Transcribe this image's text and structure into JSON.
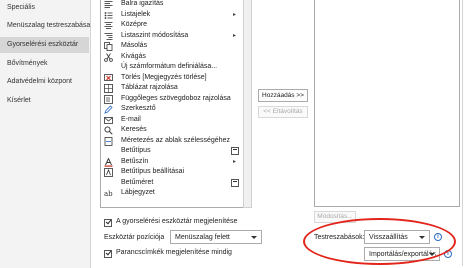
{
  "nav": {
    "items": [
      {
        "label": "Speciális"
      },
      {
        "label": "Menüszalag testreszabása"
      },
      {
        "label": "Gyorselérési eszköztár",
        "selected": true
      },
      {
        "label": "Bővítmények"
      },
      {
        "label": "Adatvédelmi központ"
      },
      {
        "label": "Kísérlet"
      }
    ]
  },
  "commands": [
    {
      "icon": "align-left-icon",
      "label": "Balra igazítás"
    },
    {
      "icon": "bullets-icon",
      "label": "Listajelek",
      "submenu": true
    },
    {
      "icon": "align-center-icon",
      "label": "Középre"
    },
    {
      "icon": "list-level-icon",
      "label": "Listaszint módosítása",
      "submenu": true
    },
    {
      "icon": "copy-icon",
      "label": "Másolás"
    },
    {
      "icon": "cut-icon",
      "label": "Kivágás"
    },
    {
      "icon": "",
      "label": "Új számformátum definiálása..."
    },
    {
      "icon": "delete-comment-icon",
      "label": "Törlés [Megjegyzés törlése]"
    },
    {
      "icon": "draw-table-icon",
      "label": "Táblázat rajzolása"
    },
    {
      "icon": "vertical-textbox-icon",
      "label": "Függőleges szövegdoboz rajzolása"
    },
    {
      "icon": "editor-icon",
      "label": "Szerkesztő"
    },
    {
      "icon": "email-icon",
      "label": "E-mail"
    },
    {
      "icon": "search-icon",
      "label": "Keresés"
    },
    {
      "icon": "fit-width-icon",
      "label": "Méretezés az ablak szélességéhez"
    },
    {
      "icon": "",
      "label": "Betűtípus",
      "selector": true
    },
    {
      "icon": "font-color-icon",
      "label": "Betűszín",
      "submenu": true
    },
    {
      "icon": "font-settings-icon",
      "label": "Betűtípus beállításai"
    },
    {
      "icon": "",
      "label": "Betűméret",
      "selector": true
    },
    {
      "icon": "footnote-icon",
      "label": "Lábjegyzet"
    }
  ],
  "buttons": {
    "add": "Hozzáadás >>",
    "remove": "<< Eltávolítás",
    "modify": "Módosítás..."
  },
  "options": {
    "show_qat": "A gyorselérési eszköztár megjelenítése",
    "position_label": "Eszköztár pozíciója",
    "position_value": "Menüszalag felett",
    "show_labels": "Parancscímkék megjelenítése mindig"
  },
  "customize": {
    "label": "Testreszabások:",
    "reset": "Visszaállítás",
    "import_export": "Importálás/exportálás"
  },
  "colors": {
    "highlight_ellipse": "#e3241b",
    "info_icon": "#2b6cc4"
  }
}
